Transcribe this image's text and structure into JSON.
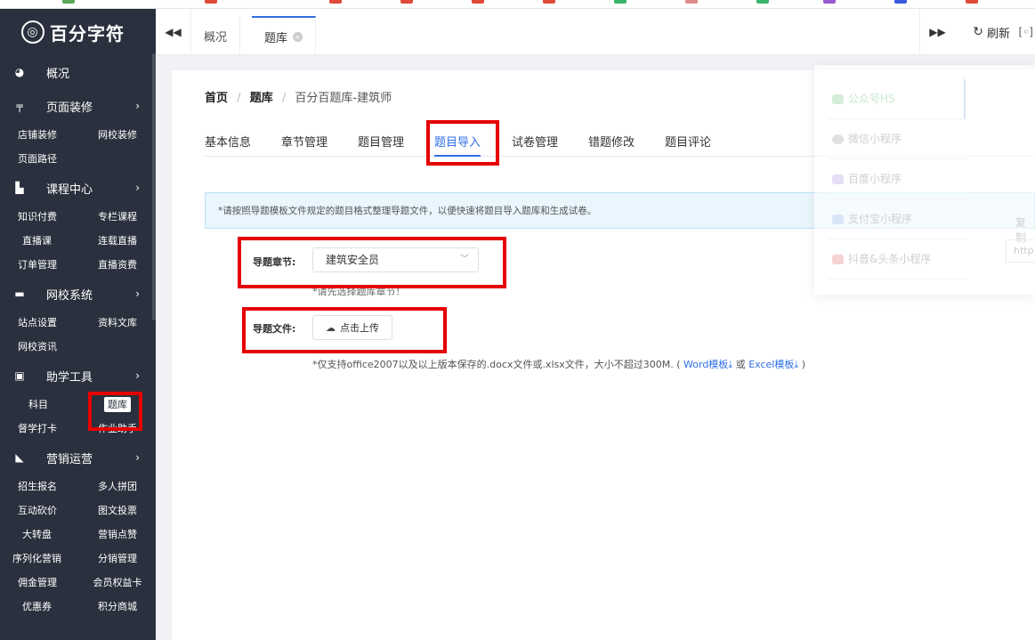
{
  "brand": {
    "logo_text": "百分字符"
  },
  "sidebar": {
    "groups": [
      {
        "label": "概况",
        "icon": "pie-chart-icon",
        "items": []
      },
      {
        "label": "页面装修",
        "icon": "brush-icon",
        "items": [
          "店铺装修",
          "网校装修",
          "页面路径"
        ]
      },
      {
        "label": "课程中心",
        "icon": "book-icon",
        "items": [
          "知识付费",
          "专栏课程",
          "直播课",
          "连载直播",
          "订单管理",
          "直播资费"
        ]
      },
      {
        "label": "网校系统",
        "icon": "monitor-icon",
        "items": [
          "站点设置",
          "资料文库",
          "网校资讯"
        ]
      },
      {
        "label": "助学工具",
        "icon": "briefcase-icon",
        "items": [
          "科目",
          "题库",
          "督学打卡",
          "作业助手"
        ]
      },
      {
        "label": "营销运营",
        "icon": "megaphone-icon",
        "items": [
          "招生报名",
          "多人拼团",
          "互动砍价",
          "图文投票",
          "大转盘",
          "营销点赞",
          "序列化营销",
          "分销管理",
          "佣金管理",
          "会员权益卡",
          "优惠券",
          "积分商城"
        ]
      }
    ],
    "active_item": "题库"
  },
  "tabbar": {
    "tabs": [
      {
        "label": "概况"
      },
      {
        "label": "题库"
      }
    ],
    "refresh_label": "刷新"
  },
  "breadcrumb": {
    "home": "首页",
    "section": "题库",
    "current": "百分百题库-建筑师",
    "sep": "/"
  },
  "content_tabs": [
    "基本信息",
    "章节管理",
    "题目管理",
    "题目导入",
    "试卷管理",
    "错题修改",
    "题目评论"
  ],
  "active_content_tab": "题目导入",
  "notice": "*请按照导题模板文件规定的题目格式整理导题文件，以便快速将题目导入题库和生成试卷。",
  "form": {
    "chapter_label": "导题章节:",
    "chapter_value": "建筑安全员",
    "chapter_hint": "*请先选择题库章节！",
    "file_label": "导题文件:",
    "upload_label": "点击上传",
    "file_hint_prefix": "*仅支持office2007以及以上版本保存的.docx文件或.xlsx文件，大小不超过300M.",
    "word_template": "Word模板",
    "or_text": "或",
    "excel_template": "Excel模板"
  },
  "popover": {
    "items": [
      "公众号H5",
      "微信小程序",
      "百度小程序",
      "支付宝小程序",
      "抖音&头条小程序"
    ],
    "copy_label": "复制",
    "input_value": "http"
  },
  "colors": {
    "sidebar_bg": "#2a303d",
    "accent": "#2f6fe4",
    "highlight": "#e60000"
  }
}
